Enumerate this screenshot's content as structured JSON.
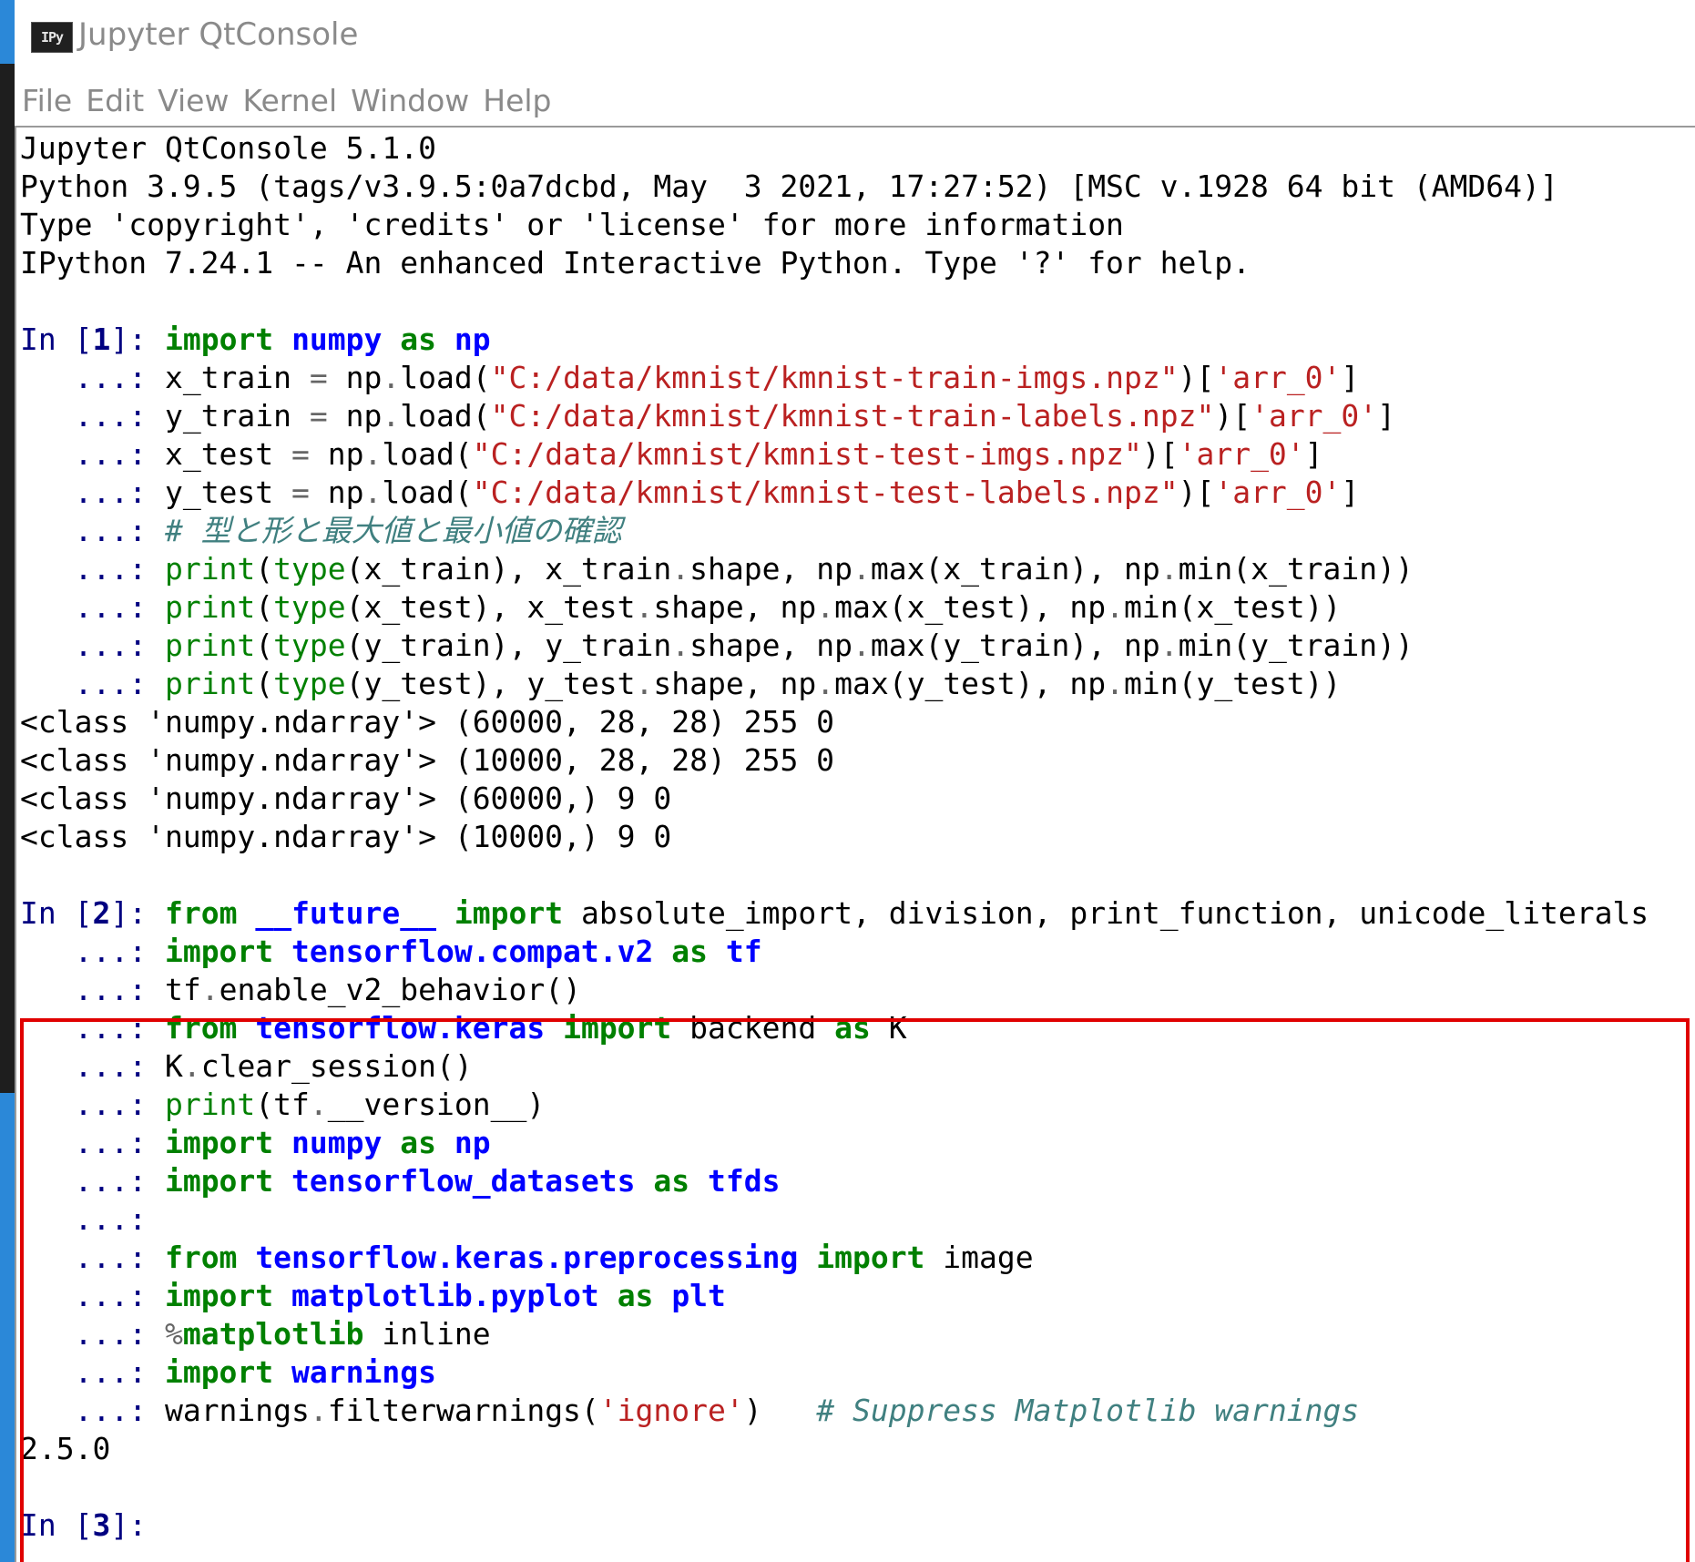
{
  "window": {
    "title": "Jupyter QtConsole",
    "icon_label": "IPy"
  },
  "menu": [
    "File",
    "Edit",
    "View",
    "Kernel",
    "Window",
    "Help"
  ],
  "banner": [
    "Jupyter QtConsole 5.1.0",
    "Python 3.9.5 (tags/v3.9.5:0a7dcbd, May  3 2021, 17:27:52) [MSC v.1928 64 bit (AMD64)]",
    "Type 'copyright', 'credits' or 'license' for more information",
    "IPython 7.24.1 -- An enhanced Interactive Python. Type '?' for help."
  ],
  "prompts": {
    "in_label": "In [",
    "in_close": "]: ",
    "cont": "   ...: "
  },
  "cells": [
    {
      "number": "1",
      "lines": [
        [
          [
            "kw",
            "import"
          ],
          [
            "t",
            " "
          ],
          [
            "mod",
            "numpy"
          ],
          [
            "t",
            " "
          ],
          [
            "kw",
            "as"
          ],
          [
            "t",
            " "
          ],
          [
            "mod",
            "np"
          ]
        ],
        [
          [
            "t",
            "x_train "
          ],
          [
            "op",
            "="
          ],
          [
            "t",
            " np"
          ],
          [
            "op",
            "."
          ],
          [
            "t",
            "load("
          ],
          [
            "str",
            "\"C:/data/kmnist/kmnist-train-imgs.npz\""
          ],
          [
            "t",
            ")["
          ],
          [
            "str",
            "'arr_0'"
          ],
          [
            "t",
            "]"
          ]
        ],
        [
          [
            "t",
            "y_train "
          ],
          [
            "op",
            "="
          ],
          [
            "t",
            " np"
          ],
          [
            "op",
            "."
          ],
          [
            "t",
            "load("
          ],
          [
            "str",
            "\"C:/data/kmnist/kmnist-train-labels.npz\""
          ],
          [
            "t",
            ")["
          ],
          [
            "str",
            "'arr_0'"
          ],
          [
            "t",
            "]"
          ]
        ],
        [
          [
            "t",
            "x_test "
          ],
          [
            "op",
            "="
          ],
          [
            "t",
            " np"
          ],
          [
            "op",
            "."
          ],
          [
            "t",
            "load("
          ],
          [
            "str",
            "\"C:/data/kmnist/kmnist-test-imgs.npz\""
          ],
          [
            "t",
            ")["
          ],
          [
            "str",
            "'arr_0'"
          ],
          [
            "t",
            "]"
          ]
        ],
        [
          [
            "t",
            "y_test "
          ],
          [
            "op",
            "="
          ],
          [
            "t",
            " np"
          ],
          [
            "op",
            "."
          ],
          [
            "t",
            "load("
          ],
          [
            "str",
            "\"C:/data/kmnist/kmnist-test-labels.npz\""
          ],
          [
            "t",
            ")["
          ],
          [
            "str",
            "'arr_0'"
          ],
          [
            "t",
            "]"
          ]
        ],
        [
          [
            "cm",
            "# 型と形と最大値と最小値の確認"
          ]
        ],
        [
          [
            "bi",
            "print"
          ],
          [
            "t",
            "("
          ],
          [
            "bi",
            "type"
          ],
          [
            "t",
            "(x_train), x_train"
          ],
          [
            "op",
            "."
          ],
          [
            "t",
            "shape, np"
          ],
          [
            "op",
            "."
          ],
          [
            "t",
            "max(x_train), np"
          ],
          [
            "op",
            "."
          ],
          [
            "t",
            "min(x_train))"
          ]
        ],
        [
          [
            "bi",
            "print"
          ],
          [
            "t",
            "("
          ],
          [
            "bi",
            "type"
          ],
          [
            "t",
            "(x_test), x_test"
          ],
          [
            "op",
            "."
          ],
          [
            "t",
            "shape, np"
          ],
          [
            "op",
            "."
          ],
          [
            "t",
            "max(x_test), np"
          ],
          [
            "op",
            "."
          ],
          [
            "t",
            "min(x_test))"
          ]
        ],
        [
          [
            "bi",
            "print"
          ],
          [
            "t",
            "("
          ],
          [
            "bi",
            "type"
          ],
          [
            "t",
            "(y_train), y_train"
          ],
          [
            "op",
            "."
          ],
          [
            "t",
            "shape, np"
          ],
          [
            "op",
            "."
          ],
          [
            "t",
            "max(y_train), np"
          ],
          [
            "op",
            "."
          ],
          [
            "t",
            "min(y_train))"
          ]
        ],
        [
          [
            "bi",
            "print"
          ],
          [
            "t",
            "("
          ],
          [
            "bi",
            "type"
          ],
          [
            "t",
            "(y_test), y_test"
          ],
          [
            "op",
            "."
          ],
          [
            "t",
            "shape, np"
          ],
          [
            "op",
            "."
          ],
          [
            "t",
            "max(y_test), np"
          ],
          [
            "op",
            "."
          ],
          [
            "t",
            "min(y_test))"
          ]
        ]
      ],
      "output": [
        "<class 'numpy.ndarray'> (60000, 28, 28) 255 0",
        "<class 'numpy.ndarray'> (10000, 28, 28) 255 0",
        "<class 'numpy.ndarray'> (60000,) 9 0",
        "<class 'numpy.ndarray'> (10000,) 9 0"
      ]
    },
    {
      "number": "2",
      "highlighted": true,
      "lines": [
        [
          [
            "kw",
            "from"
          ],
          [
            "t",
            " "
          ],
          [
            "mod",
            "__future__"
          ],
          [
            "t",
            " "
          ],
          [
            "kw",
            "import"
          ],
          [
            "t",
            " absolute_import, division, print_function, unicode_literals"
          ]
        ],
        [
          [
            "kw",
            "import"
          ],
          [
            "t",
            " "
          ],
          [
            "mod",
            "tensorflow.compat.v2"
          ],
          [
            "t",
            " "
          ],
          [
            "kw",
            "as"
          ],
          [
            "t",
            " "
          ],
          [
            "mod",
            "tf"
          ]
        ],
        [
          [
            "t",
            "tf"
          ],
          [
            "op",
            "."
          ],
          [
            "t",
            "enable_v2_behavior()"
          ]
        ],
        [
          [
            "kw",
            "from"
          ],
          [
            "t",
            " "
          ],
          [
            "mod",
            "tensorflow.keras"
          ],
          [
            "t",
            " "
          ],
          [
            "kw",
            "import"
          ],
          [
            "t",
            " backend "
          ],
          [
            "kw",
            "as"
          ],
          [
            "t",
            " K"
          ]
        ],
        [
          [
            "t",
            "K"
          ],
          [
            "op",
            "."
          ],
          [
            "t",
            "clear_session()"
          ]
        ],
        [
          [
            "bi",
            "print"
          ],
          [
            "t",
            "(tf"
          ],
          [
            "op",
            "."
          ],
          [
            "t",
            "__version__)"
          ]
        ],
        [
          [
            "kw",
            "import"
          ],
          [
            "t",
            " "
          ],
          [
            "mod",
            "numpy"
          ],
          [
            "t",
            " "
          ],
          [
            "kw",
            "as"
          ],
          [
            "t",
            " "
          ],
          [
            "mod",
            "np"
          ]
        ],
        [
          [
            "kw",
            "import"
          ],
          [
            "t",
            " "
          ],
          [
            "mod",
            "tensorflow_datasets"
          ],
          [
            "t",
            " "
          ],
          [
            "kw",
            "as"
          ],
          [
            "t",
            " "
          ],
          [
            "mod",
            "tfds"
          ]
        ],
        [],
        [
          [
            "kw",
            "from"
          ],
          [
            "t",
            " "
          ],
          [
            "mod",
            "tensorflow.keras.preprocessing"
          ],
          [
            "t",
            " "
          ],
          [
            "kw",
            "import"
          ],
          [
            "t",
            " image"
          ]
        ],
        [
          [
            "kw",
            "import"
          ],
          [
            "t",
            " "
          ],
          [
            "mod",
            "matplotlib.pyplot"
          ],
          [
            "t",
            " "
          ],
          [
            "kw",
            "as"
          ],
          [
            "t",
            " "
          ],
          [
            "mod",
            "plt"
          ]
        ],
        [
          [
            "op",
            "%"
          ],
          [
            "mg",
            "matplotlib"
          ],
          [
            "t",
            " inline"
          ]
        ],
        [
          [
            "kw",
            "import"
          ],
          [
            "t",
            " "
          ],
          [
            "mod",
            "warnings"
          ]
        ],
        [
          [
            "t",
            "warnings"
          ],
          [
            "op",
            "."
          ],
          [
            "t",
            "filterwarnings("
          ],
          [
            "str",
            "'ignore'"
          ],
          [
            "t",
            ")   "
          ],
          [
            "cm",
            "# Suppress Matplotlib warnings"
          ]
        ]
      ],
      "output": [
        "2.5.0"
      ]
    },
    {
      "number": "3",
      "lines": [],
      "output": []
    }
  ]
}
